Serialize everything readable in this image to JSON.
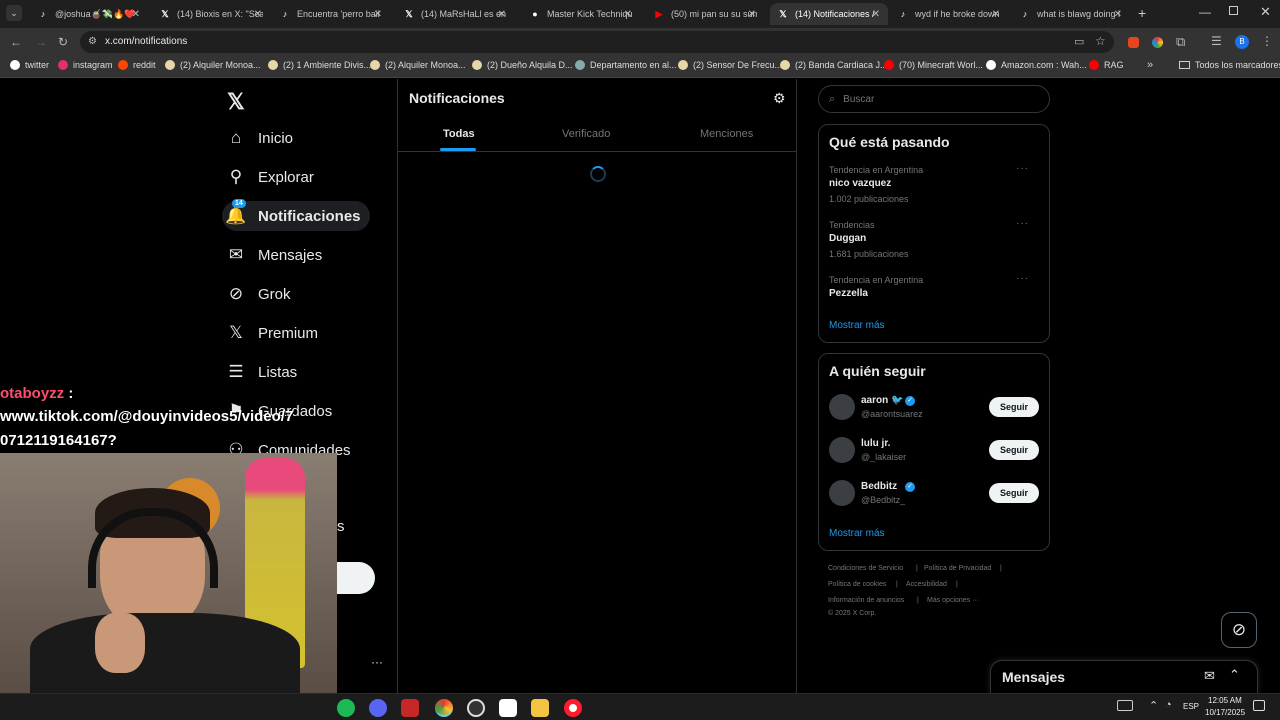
{
  "browser": {
    "tabs": [
      {
        "title": "@joshua🧉💸🔥❤️",
        "icon": "tiktok-icon",
        "color": "#ffffff"
      },
      {
        "title": "(14) Bioxis en X: \"Sca",
        "icon": "x-icon",
        "color": "#ffffff"
      },
      {
        "title": "Encuentra 'perro bail",
        "icon": "tiktok-icon",
        "color": "#ffffff"
      },
      {
        "title": "(14) MaRsHaLl es en",
        "icon": "x-icon",
        "color": "#ffffff"
      },
      {
        "title": "Master Kick Techniqu",
        "icon": "globe-icon",
        "color": "#ffffff"
      },
      {
        "title": "(50) mi pan su su sum",
        "icon": "youtube-icon",
        "color": "#ff0000"
      },
      {
        "title": "(14) Notificaciones /",
        "icon": "x-icon",
        "color": "#ffffff"
      },
      {
        "title": "wyd if he broke down",
        "icon": "tiktok-icon",
        "color": "#ffffff"
      },
      {
        "title": "what is blawg doing l",
        "icon": "tiktok-icon",
        "color": "#ffffff"
      }
    ],
    "url": "x.com/notifications",
    "bookmarks": [
      {
        "label": "twitter",
        "color": "#ffffff"
      },
      {
        "label": "instagram",
        "color": "#e1306c"
      },
      {
        "label": "reddit",
        "color": "#ff4500"
      },
      {
        "label": "(2) Alquiler Monoa...",
        "color": "#e6d6a8"
      },
      {
        "label": "(2) 1 Ambiente Divis...",
        "color": "#e6d6a8"
      },
      {
        "label": "(2) Alquiler Monoa...",
        "color": "#e6d6a8"
      },
      {
        "label": "(2) Dueño Alquila D...",
        "color": "#e6d6a8"
      },
      {
        "label": "Departamento en al...",
        "color": "#8aa"
      },
      {
        "label": "(2) Sensor De Frecu...",
        "color": "#e6d6a8"
      },
      {
        "label": "(2) Banda Cardiaca J...",
        "color": "#e6d6a8"
      },
      {
        "label": "(70) Minecraft Worl...",
        "color": "#ff0000"
      },
      {
        "label": "Amazon.com : Wah...",
        "color": "#ffffff"
      },
      {
        "label": "RAG",
        "color": "#ff0000"
      }
    ],
    "all_bookmarks": "Todos los marcadores"
  },
  "sidebar": {
    "items": [
      {
        "label": "Inicio",
        "icon": "home-icon"
      },
      {
        "label": "Explorar",
        "icon": "search-icon"
      },
      {
        "label": "Notificaciones",
        "icon": "bell-icon",
        "badge": "14"
      },
      {
        "label": "Mensajes",
        "icon": "mail-icon"
      },
      {
        "label": "Grok",
        "icon": "grok-icon"
      },
      {
        "label": "Premium",
        "icon": "x-icon"
      },
      {
        "label": "Listas",
        "icon": "list-icon"
      },
      {
        "label": "Guardados",
        "icon": "bookmark-icon"
      },
      {
        "label": "Comunidades",
        "icon": "communities-icon"
      }
    ],
    "partial_text": "s"
  },
  "main": {
    "title": "Notificaciones",
    "tabs": [
      "Todas",
      "Verificado",
      "Menciones"
    ]
  },
  "right": {
    "search_placeholder": "Buscar",
    "trending": {
      "title": "Qué está pasando",
      "items": [
        {
          "context": "Tendencia en Argentina",
          "name": "nico vazquez",
          "count": "1.002 publicaciones"
        },
        {
          "context": "Tendencias",
          "name": "Duggan",
          "count": "1.681 publicaciones"
        },
        {
          "context": "Tendencia en Argentina",
          "name": "Pezzella",
          "count": ""
        }
      ],
      "show_more": "Mostrar más"
    },
    "follow": {
      "title": "A quién seguir",
      "users": [
        {
          "name": "aaron 🐦",
          "handle": "@aarontsuarez",
          "button": "Seguir"
        },
        {
          "name": "lulu jr.",
          "handle": "@_lakaiser",
          "button": "Seguir"
        },
        {
          "name": "Bedbitz",
          "handle": "@Bedbitz_",
          "button": "Seguir"
        }
      ],
      "show_more": "Mostrar más"
    },
    "footer": {
      "line1": [
        "Condiciones de Servicio",
        "Política de Privacidad"
      ],
      "line2": [
        "Política de cookies",
        "Accesibilidad"
      ],
      "line3": [
        "Información de anuncios",
        "Más opciones ···"
      ],
      "copyright": "© 2025 X Corp."
    },
    "messages_dock": "Mensajes"
  },
  "overlay": {
    "chat_user": "otaboyzz",
    "chat_lines": [
      "www.tiktok.com/@douyinvideos5/video/7",
      "0712119164167?"
    ]
  },
  "taskbar": {
    "time": "12:05 AM",
    "date": "10/17/2025",
    "lang": "ESP"
  }
}
